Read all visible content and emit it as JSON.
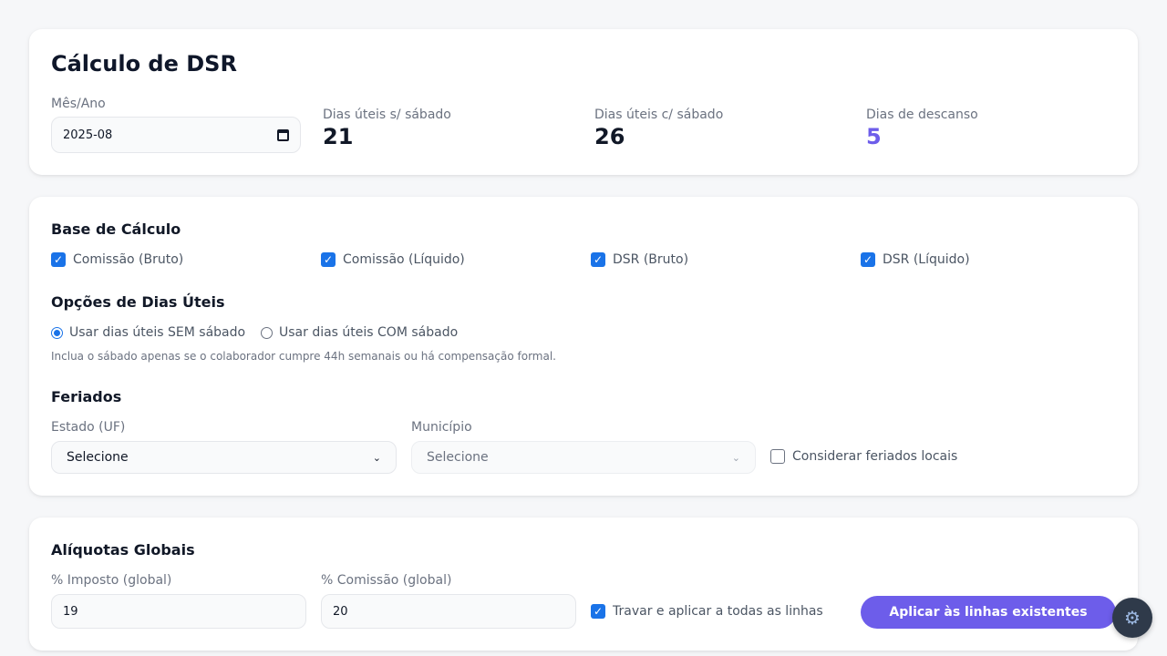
{
  "header": {
    "title": "Cálculo de DSR",
    "month_label": "Mês/Ano",
    "month_value": "2025-08",
    "stats": [
      {
        "label": "Dias úteis s/ sábado",
        "value": "21"
      },
      {
        "label": "Dias úteis c/ sábado",
        "value": "26"
      },
      {
        "label": "Dias de descanso",
        "value": "5"
      }
    ]
  },
  "base": {
    "title": "Base de Cálculo",
    "options": [
      {
        "label": "Comissão (Bruto)",
        "checked": true
      },
      {
        "label": "Comissão (Líquido)",
        "checked": true
      },
      {
        "label": "DSR (Bruto)",
        "checked": true
      },
      {
        "label": "DSR (Líquido)",
        "checked": true
      }
    ]
  },
  "workdays": {
    "title": "Opções de Dias Úteis",
    "options": [
      {
        "label": "Usar dias úteis SEM sábado",
        "selected": true
      },
      {
        "label": "Usar dias úteis COM sábado",
        "selected": false
      }
    ],
    "hint": "Inclua o sábado apenas se o colaborador cumpre 44h semanais ou há compensação formal."
  },
  "holidays": {
    "title": "Feriados",
    "state_label": "Estado (UF)",
    "state_value": "Selecione",
    "city_label": "Município",
    "city_value": "Selecione",
    "local_label": "Considerar feriados locais",
    "local_checked": false
  },
  "rates": {
    "title": "Alíquotas Globais",
    "tax_label": "% Imposto (global)",
    "tax_value": "19",
    "commission_label": "% Comissão (global)",
    "commission_value": "20",
    "lock_label": "Travar e aplicar a todas as linhas",
    "lock_checked": true,
    "apply_label": "Aplicar às linhas existentes"
  },
  "colors": {
    "accent": "#6d5dea",
    "checkbox": "#1a73e8"
  },
  "icons": {
    "date": "calendar-icon",
    "select": "chevron-down-icon",
    "fab": "gear-icon"
  }
}
